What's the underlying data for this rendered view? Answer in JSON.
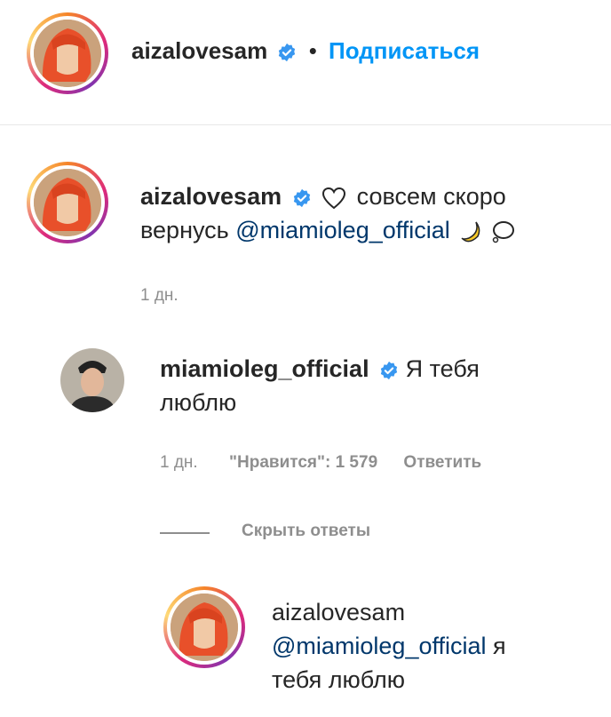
{
  "header": {
    "username": "aizalovesam",
    "separator": "•",
    "follow_label": "Подписаться"
  },
  "caption": {
    "username": "aizalovesam",
    "text_before": "совсем скоро",
    "text_line2": "вернусь",
    "mention": "@miamioleg_official",
    "time": "1 дн."
  },
  "reply1": {
    "username": "miamioleg_official",
    "text_line1": "Я тебя",
    "text_line2": "люблю",
    "time": "1 дн.",
    "likes": "\"Нравится\": 1 579",
    "reply_label": "Ответить"
  },
  "hide_replies_label": "Скрыть ответы",
  "reply2": {
    "username": "aizalovesam",
    "mention": "@miamioleg_official",
    "text_after": "я",
    "text_line3": "тебя люблю"
  },
  "colors": {
    "follow_blue": "#0095f6",
    "mention_blue": "#00376b",
    "verified_blue": "#3897f0",
    "secondary_gray": "#8e8e8e"
  }
}
